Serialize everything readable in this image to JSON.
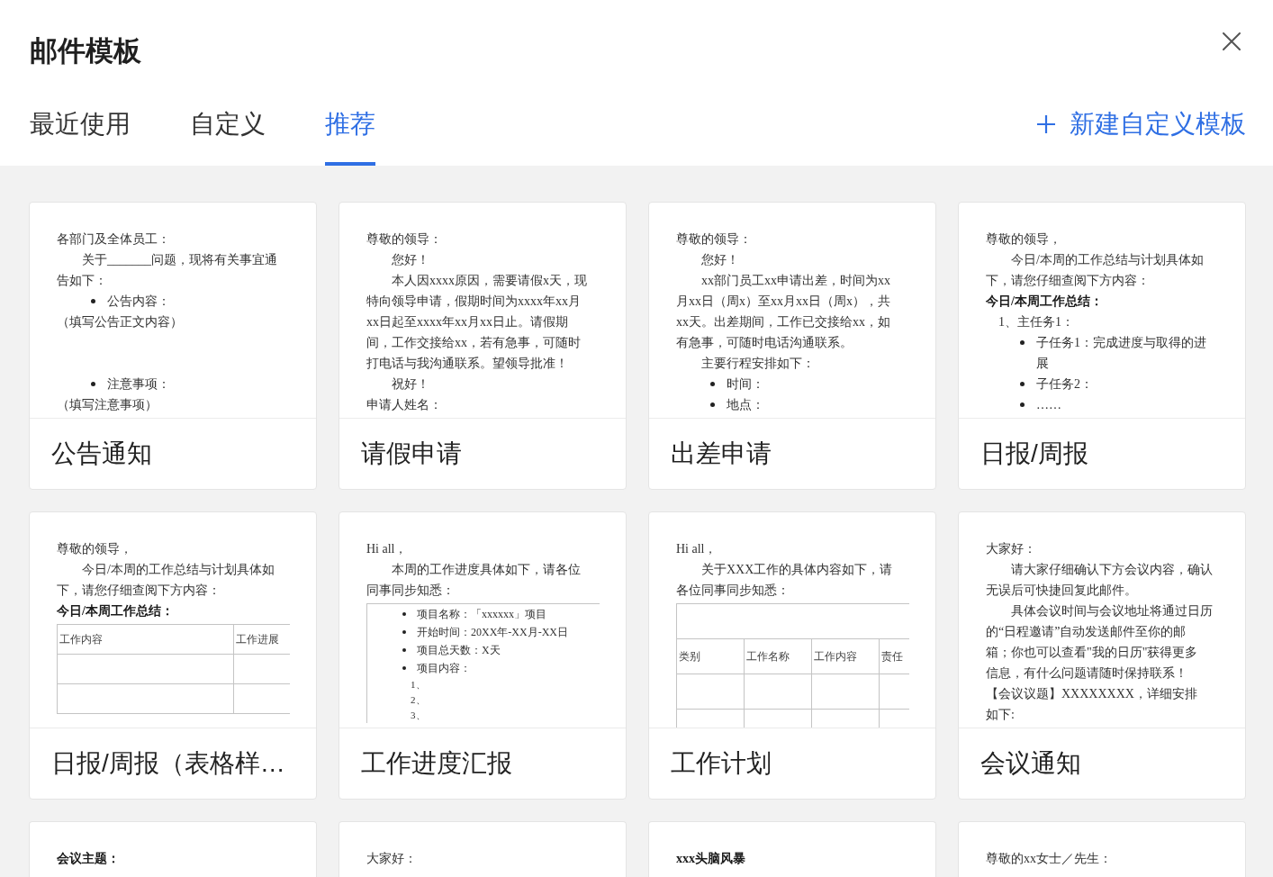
{
  "dialog": {
    "title": "邮件模板"
  },
  "tabs": [
    {
      "label": "最近使用",
      "selected": false
    },
    {
      "label": "自定义",
      "selected": false
    },
    {
      "label": "推荐",
      "selected": true
    }
  ],
  "new_template_button": {
    "label": "新建自定义模板"
  },
  "templates": [
    {
      "title": "公告通知",
      "preview": [
        {
          "kind": "line",
          "text": "各部门及全体员工："
        },
        {
          "kind": "indent",
          "lines": [
            "关于_______问题，现将有关事宜通",
            "告如下："
          ]
        },
        {
          "kind": "bullet",
          "text": "公告内容："
        },
        {
          "kind": "line",
          "text": "（填写公告正文内容）"
        },
        {
          "kind": "blank"
        },
        {
          "kind": "blank"
        },
        {
          "kind": "bullet",
          "text": "注意事项："
        },
        {
          "kind": "line",
          "text": "（填写注意事项）"
        }
      ]
    },
    {
      "title": "请假申请",
      "preview": [
        {
          "kind": "line",
          "text": "尊敬的领导："
        },
        {
          "kind": "indent",
          "text": "您好！"
        },
        {
          "kind": "indent",
          "lines": [
            "本人因xxxx原因，需要请假x天，现",
            "特向领导申请，假期时间为xxxx年xx月",
            "xx日起至xxxx年xx月xx日止。请假期",
            "间，工作交接给xx，若有急事，可随时",
            "打电话与我沟通联系。望领导批准！"
          ]
        },
        {
          "kind": "indent",
          "text": "祝好！"
        },
        {
          "kind": "line",
          "text": "申请人姓名："
        }
      ]
    },
    {
      "title": "出差申请",
      "preview": [
        {
          "kind": "line",
          "text": "尊敬的领导："
        },
        {
          "kind": "indent",
          "text": "您好！"
        },
        {
          "kind": "indent",
          "lines": [
            "xx部门员工xx申请出差，时间为xx",
            "月xx日（周x）至xx月xx日（周x），共",
            "xx天。出差期间，工作已交接给xx，如",
            "有急事，可随时电话沟通联系。"
          ]
        },
        {
          "kind": "indent",
          "text": "主要行程安排如下："
        },
        {
          "kind": "bullet",
          "text": "时间："
        },
        {
          "kind": "bullet",
          "text": "地点："
        }
      ]
    },
    {
      "title": "日报/周报",
      "preview": [
        {
          "kind": "line",
          "text": "尊敬的领导，"
        },
        {
          "kind": "indent",
          "lines": [
            "今日/本周的工作总结与计划具体如",
            "下，请您仔细查阅下方内容："
          ]
        },
        {
          "kind": "heading",
          "text": "今日/本周工作总结："
        },
        {
          "kind": "numbered",
          "text": "1、主任务1："
        },
        {
          "kind": "bullet",
          "lines": [
            "子任务1：完成进度与取得的进",
            "展"
          ]
        },
        {
          "kind": "bullet",
          "text": "子任务2："
        },
        {
          "kind": "bullet",
          "text": "……"
        }
      ]
    },
    {
      "title": "日报/周报（表格样…",
      "preview": [
        {
          "kind": "line",
          "text": "尊敬的领导，"
        },
        {
          "kind": "indent",
          "lines": [
            "今日/本周的工作总结与计划具体如",
            "下，请您仔细查阅下方内容："
          ]
        },
        {
          "kind": "heading",
          "text": "今日/本周工作总结："
        },
        {
          "kind": "table",
          "columns": [
            "工作内容",
            "工作进展"
          ]
        }
      ]
    },
    {
      "title": "工作进度汇报",
      "preview": [
        {
          "kind": "line",
          "text": "Hi all，"
        },
        {
          "kind": "indent",
          "lines": [
            "本周的工作进度具体如下，请各位",
            "同事同步知悉："
          ]
        },
        {
          "kind": "frame",
          "blocks": [
            {
              "kind": "bullet",
              "text": "项目名称：「xxxxxx」项目"
            },
            {
              "kind": "bullet",
              "text": "开始时间：20XX年-XX月-XX日"
            },
            {
              "kind": "bullet",
              "text": "项目总天数：X天"
            },
            {
              "kind": "bullet",
              "text": "项目内容："
            },
            {
              "kind": "number",
              "text": "1、"
            },
            {
              "kind": "number",
              "text": "2、"
            },
            {
              "kind": "number",
              "text": "3、"
            }
          ]
        }
      ]
    },
    {
      "title": "工作计划",
      "preview": [
        {
          "kind": "line",
          "text": "Hi all，"
        },
        {
          "kind": "indent",
          "lines": [
            "关于XXX工作的具体内容如下，请",
            "各位同事同步知悉："
          ]
        },
        {
          "kind": "table",
          "blank_top_row": true,
          "columns": [
            "类别",
            "工作名称",
            "工作内容",
            "责任"
          ]
        }
      ]
    },
    {
      "title": "会议通知",
      "preview": [
        {
          "kind": "line",
          "text": "大家好："
        },
        {
          "kind": "indent",
          "lines": [
            "请大家仔细确认下方会议内容，确认",
            "无误后可快捷回复此邮件。"
          ]
        },
        {
          "kind": "indent",
          "lines": [
            "具体会议时间与会议地址将通过日历",
            "的“日程邀请”自动发送邮件至你的邮",
            "箱；你也可以查看\"我的日历\"获得更多",
            "信息，有什么问题请随时保持联系！"
          ]
        },
        {
          "kind": "line",
          "lines": [
            "【会议议题】XXXXXXXX，详细安排",
            "如下:"
          ]
        }
      ]
    },
    {
      "preview": [
        {
          "kind": "heading",
          "text": "会议主题："
        }
      ]
    },
    {
      "preview": [
        {
          "kind": "line",
          "text": "大家好："
        }
      ]
    },
    {
      "preview": [
        {
          "kind": "heading",
          "text": "xxx头脑风暴"
        }
      ]
    },
    {
      "preview": [
        {
          "kind": "line",
          "text": "尊敬的xx女士／先生："
        }
      ]
    }
  ]
}
